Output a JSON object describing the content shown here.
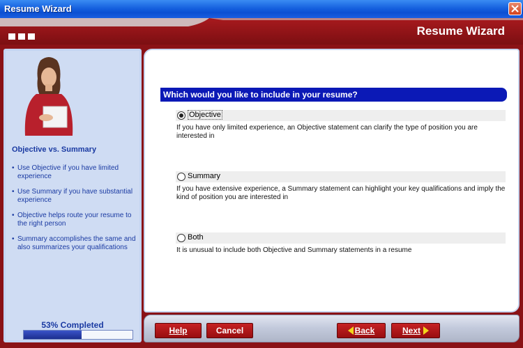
{
  "window": {
    "title": "Resume Wizard"
  },
  "header": {
    "title": "Resume Wizard"
  },
  "sidebar": {
    "title": "Objective vs. Summary",
    "tips": [
      "Use Objective if you have limited experience",
      "Use Summary if you have substantial experience",
      "Objective helps route your resume to the right person",
      "Summary accomplishes the same and also summarizes your qualifications"
    ],
    "progress_label": "53% Completed",
    "progress_value": 0.53
  },
  "main": {
    "question": "Which would you like to include in your resume?",
    "options": [
      {
        "label": "Objective",
        "selected": true,
        "description": "If you have only limited experience, an Objective statement can clarify the type of position you are interested in"
      },
      {
        "label": "Summary",
        "selected": false,
        "description": "If you have extensive experience, a Summary statement can highlight your key qualifications and imply the kind of position you are interested in"
      },
      {
        "label": "Both",
        "selected": false,
        "description": "It is unusual to include both Objective and Summary statements in a resume"
      }
    ]
  },
  "buttons": {
    "help": "Help",
    "cancel": "Cancel",
    "back": "Back",
    "next": "Next"
  },
  "colors": {
    "brand_red": "#8a1216",
    "question_blue": "#0b19b6",
    "titlebar_blue": "#1661df",
    "arrow_yellow": "#f2d81c"
  },
  "icons": {
    "close": "close-icon",
    "decor": "squares-icon",
    "back": "arrow-left-icon",
    "next": "arrow-right-icon"
  }
}
